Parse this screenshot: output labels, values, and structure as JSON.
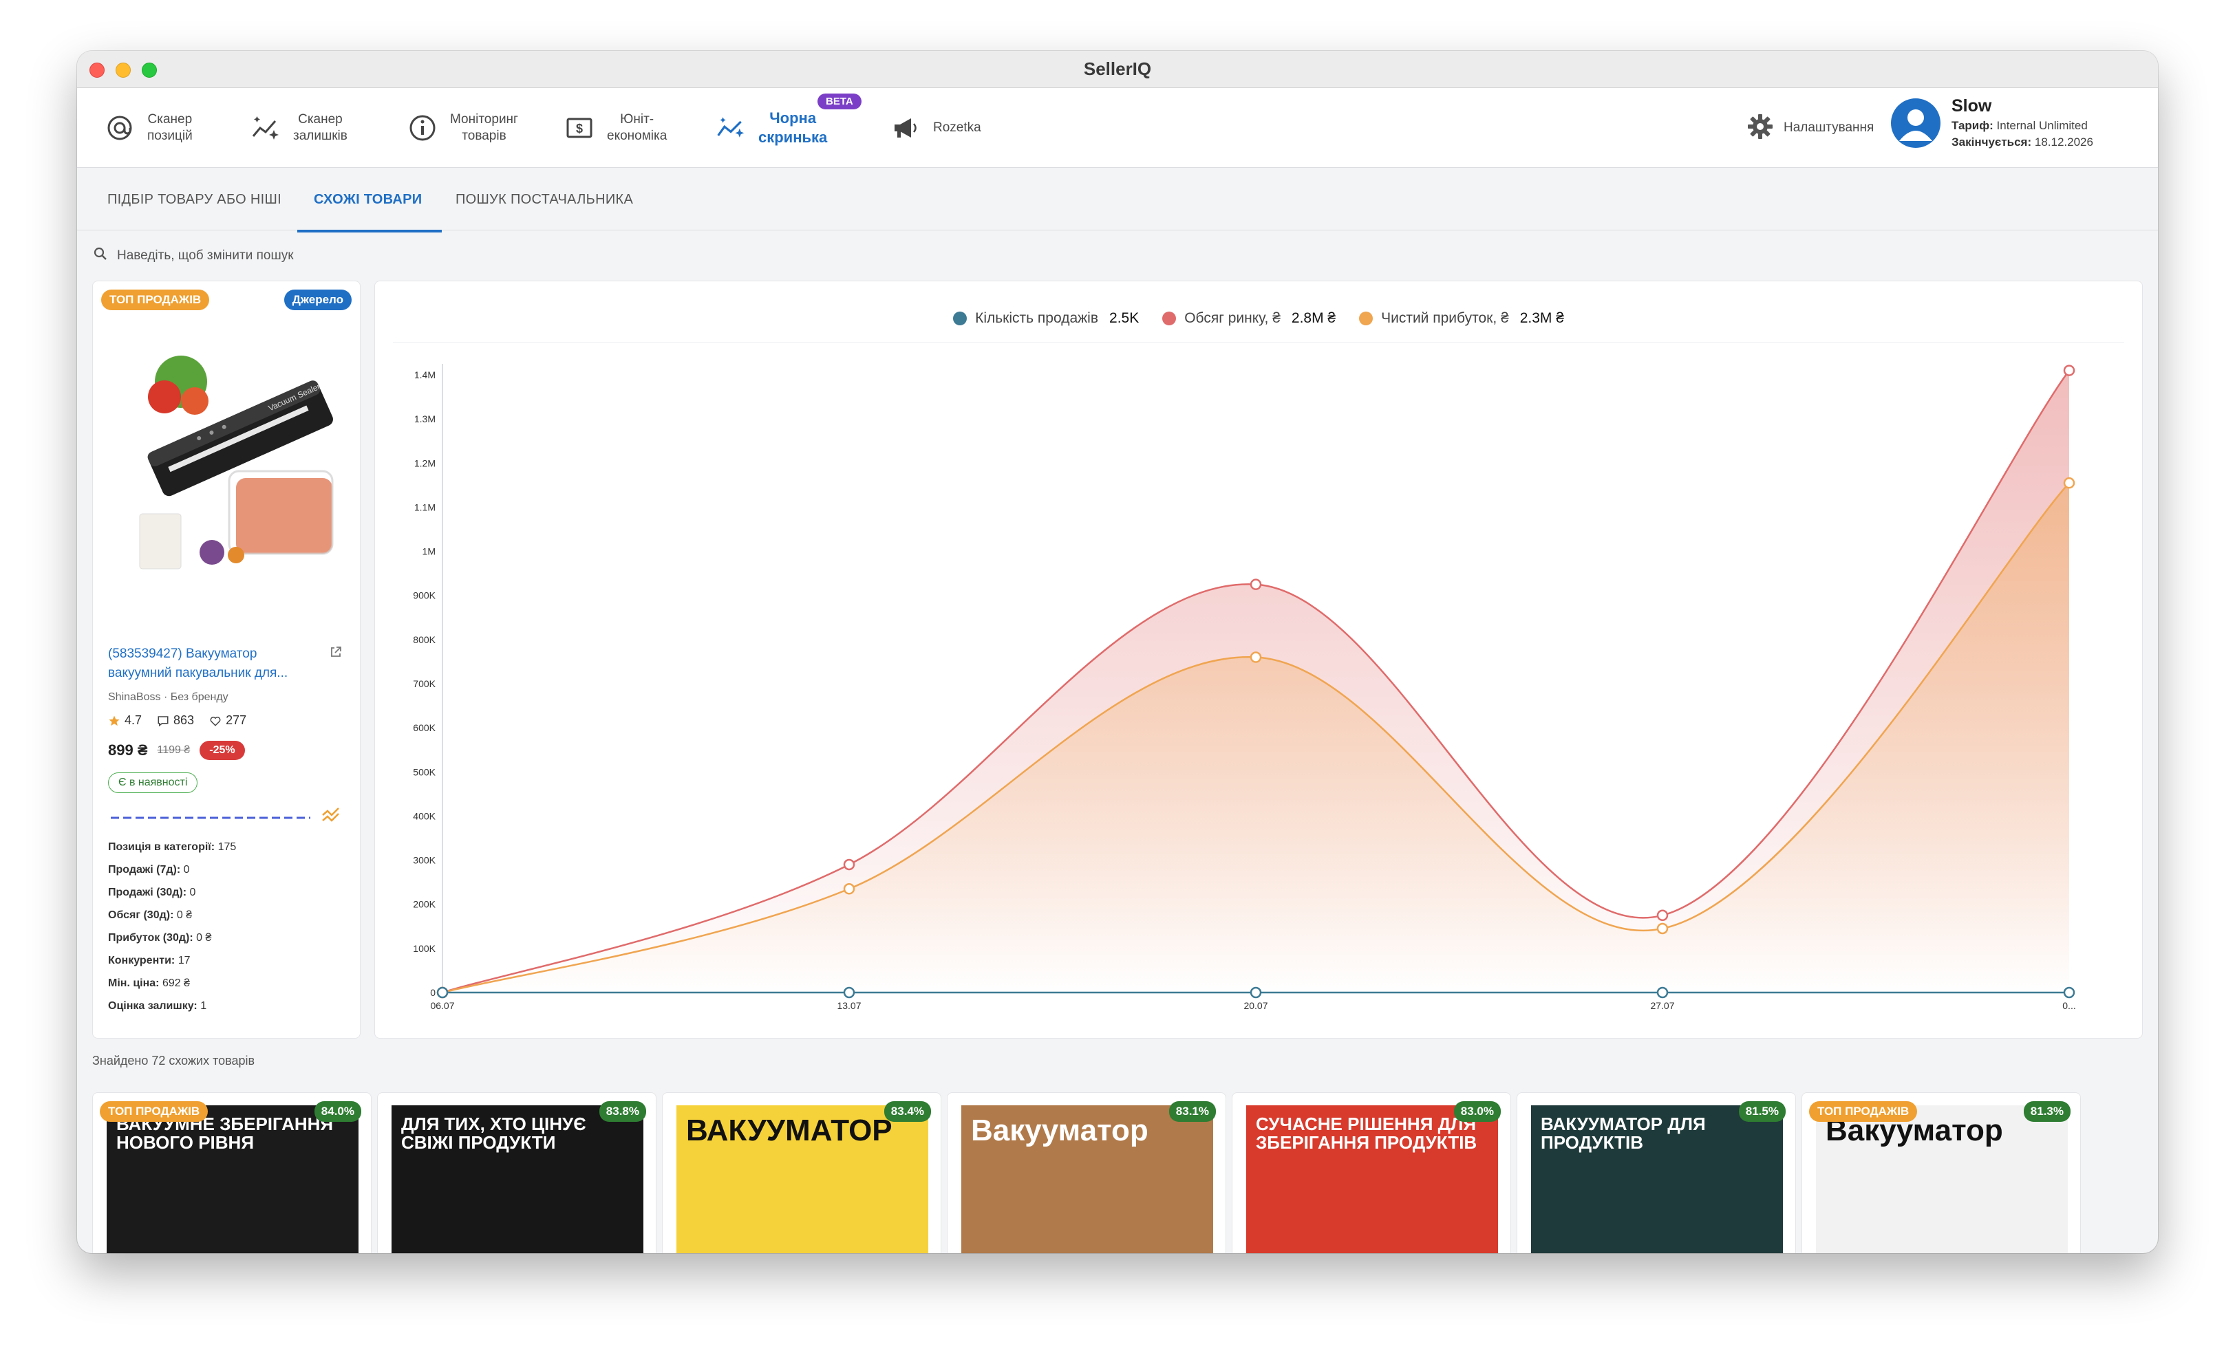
{
  "window": {
    "title": "SellerIQ"
  },
  "nav": {
    "items": [
      {
        "label": "Сканер\nпозицій",
        "icon": "at-target-icon"
      },
      {
        "label": "Сканер\nзалишків",
        "icon": "sparkle-trend-icon"
      },
      {
        "label": "Моніторинг\nтоварів",
        "icon": "info-circle-icon"
      },
      {
        "label": "Юніт-\nекономіка",
        "icon": "dollar-box-icon"
      },
      {
        "label": "Чорна\nскринька",
        "icon": "trend-sparkle-icon",
        "badge": "BETA"
      },
      {
        "label": "Rozetka",
        "icon": "megaphone-icon"
      }
    ],
    "settings_label": "Налаштування",
    "user": {
      "name": "Slow",
      "plan_label": "Тариф:",
      "plan_value": "Internal Unlimited",
      "expires_label": "Закінчується:",
      "expires_value": "18.12.2026"
    }
  },
  "subtabs": [
    {
      "label": "ПІДБІР ТОВАРУ АБО НІШІ"
    },
    {
      "label": "СХОЖІ ТОВАРИ",
      "active": true
    },
    {
      "label": "ПОШУК ПОСТАЧАЛЬНИКА"
    }
  ],
  "search": {
    "placeholder": "Наведіть, щоб змінити пошук"
  },
  "product": {
    "badge_top": "ТОП ПРОДАЖІВ",
    "badge_source": "Джерело",
    "image_text": "Vacuum Sealer",
    "title": "(583539427) Вакууматор вакуумний пакувальник для...",
    "seller": "ShinaBoss · Без бренду",
    "rating": "4.7",
    "reviews": "863",
    "likes": "277",
    "price": "899 ₴",
    "old_price": "1199 ₴",
    "discount": "-25%",
    "stock": "Є в наявності",
    "metrics": [
      {
        "label": "Позиція в категорії:",
        "value": "175"
      },
      {
        "label": "Продажі (7д):",
        "value": "0"
      },
      {
        "label": "Продажі (30д):",
        "value": "0"
      },
      {
        "label": "Обсяг (30д):",
        "value": "0 ₴"
      },
      {
        "label": "Прибуток (30д):",
        "value": "0 ₴"
      },
      {
        "label": "Конкуренти:",
        "value": "17"
      },
      {
        "label": "Мін. ціна:",
        "value": "692 ₴"
      },
      {
        "label": "Оцінка залишку:",
        "value": "1"
      }
    ]
  },
  "chart_data": {
    "type": "area",
    "x": [
      "06.07",
      "13.07",
      "20.07",
      "27.07",
      "0..."
    ],
    "ylim": [
      0,
      1400000
    ],
    "yticks": [
      "0",
      "100K",
      "200K",
      "300K",
      "400K",
      "500K",
      "600K",
      "700K",
      "800K",
      "900K",
      "1M",
      "1.1M",
      "1.2M",
      "1.3M",
      "1.4M"
    ],
    "grid": false,
    "legend_position": "top-center",
    "series": [
      {
        "name": "Кількість продажів",
        "summary": "2.5K",
        "color": "#3d7a94",
        "values": [
          0,
          0,
          0,
          0,
          0
        ]
      },
      {
        "name": "Обсяг ринку, ₴",
        "summary": "2.8M ₴",
        "color": "#e06b6b",
        "values": [
          0,
          290000,
          925000,
          175000,
          1410000
        ]
      },
      {
        "name": "Чистий прибуток, ₴",
        "summary": "2.3M ₴",
        "color": "#f0a550",
        "values": [
          0,
          235000,
          760000,
          145000,
          1155000
        ]
      }
    ]
  },
  "similar": {
    "found_text": "Знайдено 72 схожих товарів",
    "items": [
      {
        "score": "84.0%",
        "badge": "ТОП ПРОДАЖІВ",
        "text": "ВАКУУМНЕ ЗБЕРІГАННЯ НОВОГО РІВНЯ",
        "bg": "#1b1b1b",
        "fg": "#ffffff"
      },
      {
        "score": "83.8%",
        "text": "ДЛЯ ТИХ, ХТО ЦІНУЄ СВІЖІ ПРОДУКТИ",
        "bg": "#171717",
        "fg": "#ffffff"
      },
      {
        "score": "83.4%",
        "text": "ВАКУУМАТОР",
        "bg": "#f6d23a",
        "fg": "#111111"
      },
      {
        "score": "83.1%",
        "text": "Вакууматор",
        "bg": "#b07a4a",
        "fg": "#ffffff"
      },
      {
        "score": "83.0%",
        "text": "СУЧАСНЕ РІШЕННЯ ДЛЯ ЗБЕРІГАННЯ ПРОДУКТІВ",
        "bg": "#d83a2c",
        "fg": "#ffffff"
      },
      {
        "score": "81.5%",
        "text": "ВАКУУМАТОР ДЛЯ ПРОДУКТІВ",
        "bg": "#1f3a3a",
        "fg": "#ffffff"
      },
      {
        "score": "81.3%",
        "badge": "ТОП ПРОДАЖІВ",
        "text": "Вакууматор",
        "bg": "#f2f2f2",
        "fg": "#111111"
      }
    ]
  }
}
